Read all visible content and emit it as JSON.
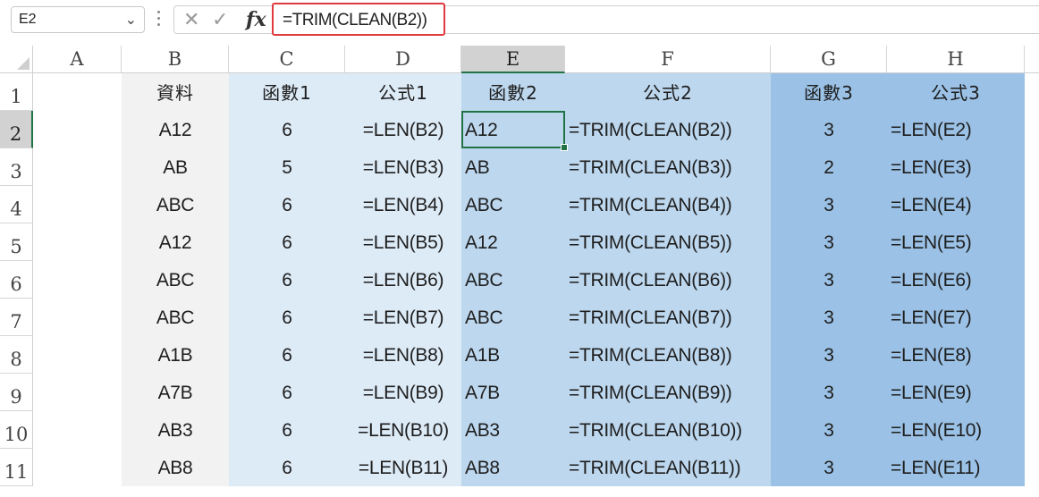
{
  "name_box": {
    "value": "E2"
  },
  "formula_bar": {
    "formula": "=TRIM(CLEAN(B2))",
    "fx_label": "fx"
  },
  "columns": [
    "A",
    "B",
    "C",
    "D",
    "E",
    "F",
    "G",
    "H"
  ],
  "rows": [
    "1",
    "2",
    "3",
    "4",
    "5",
    "6",
    "7",
    "8",
    "9",
    "10",
    "11"
  ],
  "selected": {
    "column": "E",
    "row": "2"
  },
  "colors": {
    "band_light": "#ddebf7",
    "band_mid": "#bdd7ee",
    "band_dark": "#9bc2e6",
    "gray_band": "#f2f2f2",
    "accent": "#217346",
    "highlight_border": "#e0393e"
  },
  "table": {
    "headers": [
      "資料",
      "函數1",
      "公式1",
      "函數2",
      "公式2",
      "函數3",
      "公式3"
    ],
    "rows": [
      [
        "A12",
        "6",
        "=LEN(B2)",
        "A12",
        "=TRIM(CLEAN(B2))",
        "3",
        "=LEN(E2)"
      ],
      [
        "AB",
        "5",
        "=LEN(B3)",
        "AB",
        "=TRIM(CLEAN(B3))",
        "2",
        "=LEN(E3)"
      ],
      [
        "ABC",
        "6",
        "=LEN(B4)",
        "ABC",
        "=TRIM(CLEAN(B4))",
        "3",
        "=LEN(E4)"
      ],
      [
        "A12",
        "6",
        "=LEN(B5)",
        "A12",
        "=TRIM(CLEAN(B5))",
        "3",
        "=LEN(E5)"
      ],
      [
        "ABC",
        "6",
        "=LEN(B6)",
        "ABC",
        "=TRIM(CLEAN(B6))",
        "3",
        "=LEN(E6)"
      ],
      [
        "ABC",
        "6",
        "=LEN(B7)",
        "ABC",
        "=TRIM(CLEAN(B7))",
        "3",
        "=LEN(E7)"
      ],
      [
        "A1B",
        "6",
        "=LEN(B8)",
        "A1B",
        "=TRIM(CLEAN(B8))",
        "3",
        "=LEN(E8)"
      ],
      [
        "A7B",
        "6",
        "=LEN(B9)",
        "A7B",
        "=TRIM(CLEAN(B9))",
        "3",
        "=LEN(E9)"
      ],
      [
        "AB3",
        "6",
        "=LEN(B10)",
        "AB3",
        "=TRIM(CLEAN(B10))",
        "3",
        "=LEN(E10)"
      ],
      [
        "AB8",
        "6",
        "=LEN(B11)",
        "AB8",
        "=TRIM(CLEAN(B11))",
        "3",
        "=LEN(E11)"
      ]
    ]
  }
}
